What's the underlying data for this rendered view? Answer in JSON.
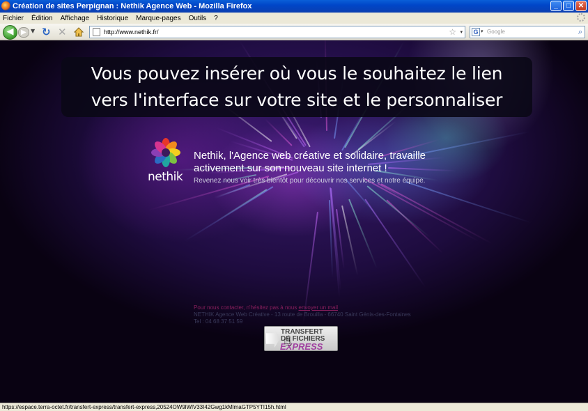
{
  "window": {
    "title": "Création de sites Perpignan : Nethik Agence Web - Mozilla Firefox",
    "controls": {
      "minimize": "_",
      "maximize": "□",
      "close": "✕"
    }
  },
  "menu": {
    "items": [
      "Fichier",
      "Édition",
      "Affichage",
      "Historique",
      "Marque-pages",
      "Outils",
      "?"
    ]
  },
  "toolbar": {
    "back": "◀",
    "forward": "▶",
    "dropdown": "▼",
    "reload": "↻",
    "stop": "✕",
    "url": "http://www.nethik.fr/",
    "url_star": "☆",
    "url_drop": "▾",
    "search_placeholder": "Google",
    "search_engine": "G",
    "search_drop": "▾",
    "search_go": "⌕"
  },
  "banner": {
    "line1": "Vous pouvez insérer où vous le souhaitez le lien",
    "line2": "vers l'interface sur votre site et le personnaliser"
  },
  "site": {
    "logo_text": "nethik",
    "headline_line1": "Nethik, l'Agence web créative et solidaire, travaille",
    "headline_line2": "activement sur son nouveau site internet !",
    "subline": "Revenez nous voir très bientôt pour découvrir nos services et notre équipe.",
    "contact_prefix": "Pour nous contacter, n'hésitez pas à nous ",
    "contact_link": "envoyer un mail",
    "address": "NETHIK Agence Web Créative - 13 route de Brouilla - 66740 Saint Génis-des-Fontaines",
    "phone": "Tel : 04 68 37 51 59"
  },
  "transfer_button": {
    "line1": "TRANSFERT",
    "line2": "DE FICHIERS",
    "line3": "EXPRESS"
  },
  "status": {
    "text": "https://espace.terra-octet.fr/transfert-express/transfert-express,20524OW9lWlV33I42Gwg1kMlmaGTP5YTI15h.html"
  },
  "colors": {
    "titlebar": "#0046c8",
    "chrome": "#ece9d8",
    "page_bg": "#1e0c3f",
    "contact_link": "#8a1f5e",
    "express": "#a040a0"
  }
}
